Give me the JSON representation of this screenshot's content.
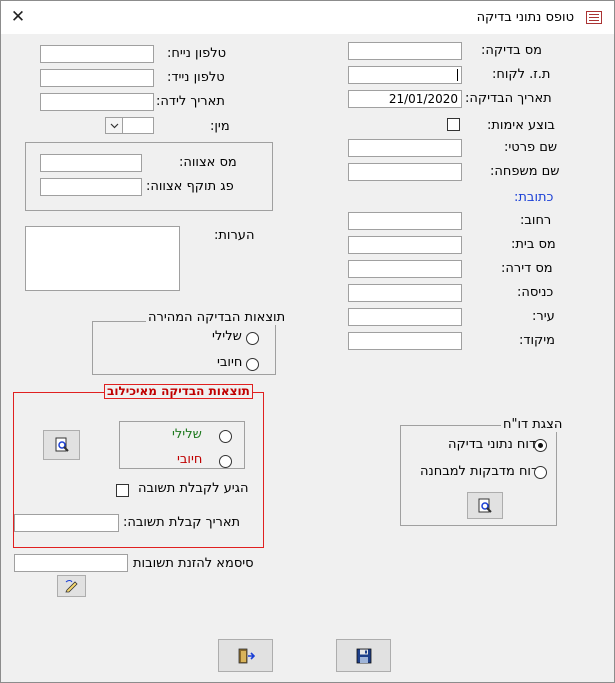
{
  "window": {
    "title": "טופס נתוני בדיקה",
    "close_glyph": "✕"
  },
  "left": {
    "phone_label": "טלפון נייח:",
    "mobile_label": "טלפון נייד:",
    "birthdate_label": "תאריך לידה:",
    "gender_label": "מין:",
    "gender_value": "",
    "cert_number_label": "מס אצווה:",
    "cert_expiry_label": "פג תוקף אצווה:",
    "notes_label": "הערות:",
    "rapid_test": {
      "title": "תוצאות הבדיקה המהירה",
      "negative": "שלילי",
      "positive": "חיובי"
    },
    "lab_test": {
      "title": "תוצאות הבדיקה מאיכילוב",
      "negative": "שלילי",
      "positive": "חיובי",
      "answer_received": "הגיע לקבלת תשובה",
      "answer_date_label": "תאריך קבלת תשובה:"
    },
    "password_label": "סיסמא להזנת תשובות"
  },
  "right": {
    "test_number_label": "מס בדיקה:",
    "customer_id_label": "ת.ז. לקוח:",
    "test_date_label": "תאריך הבדיקה:",
    "test_date_value": "21/01/2020",
    "verified_label": "בוצע אימות:",
    "first_name_label": "שם פרטי:",
    "last_name_label": "שם משפחה:",
    "address_heading": "כתובת:",
    "street_label": "רחוב:",
    "house_number_label": "מס בית:",
    "apartment_label": "מס דירה:",
    "entrance_label": "כניסה:",
    "city_label": "עיר:",
    "zip_label": "מיקוד:",
    "report": {
      "title": "הצגת דו\"ח",
      "option_test_data": "דוח נתוני בדיקה",
      "option_tested_lab": "דוח מדבקות למבחנה"
    }
  }
}
